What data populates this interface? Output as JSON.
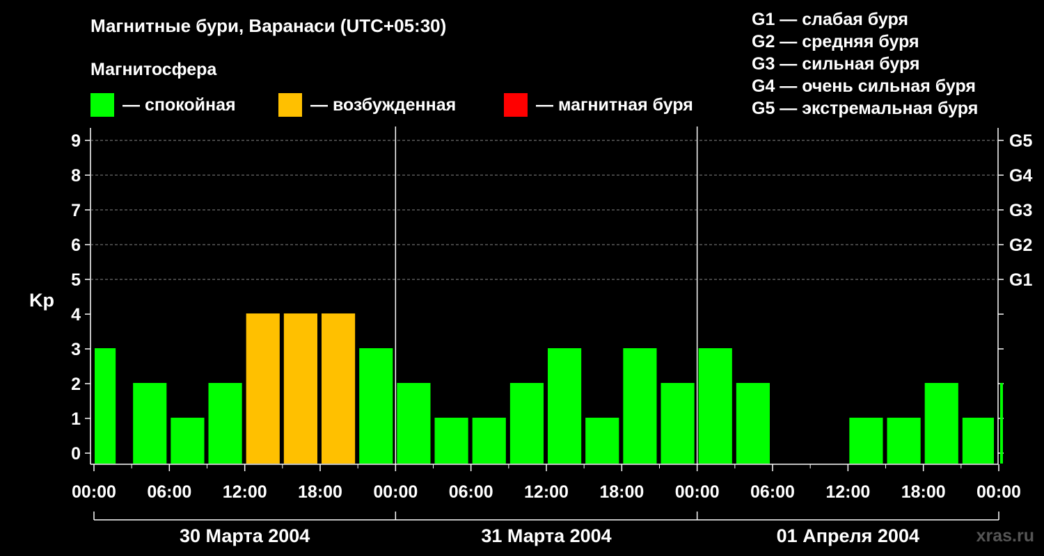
{
  "header": {
    "title": "Магнитные бури, Варанаси (UTC+05:30)",
    "subtitle": "Магнитосфера"
  },
  "legend": [
    {
      "label": "— спокойная",
      "color": "#00ff00"
    },
    {
      "label": "— возбужденная",
      "color": "#ffc000"
    },
    {
      "label": "— магнитная буря",
      "color": "#ff0000"
    }
  ],
  "storm_levels": [
    "G1 — слабая буря",
    "G2 — средняя буря",
    "G3 — сильная буря",
    "G4 — очень сильная буря",
    "G5 — экстремальная буря"
  ],
  "watermark": "xras.ru",
  "chart_data": {
    "type": "bar",
    "ylabel": "Kp",
    "ylim": [
      0,
      9
    ],
    "yticks": [
      "0",
      "1",
      "2",
      "3",
      "4",
      "5",
      "6",
      "7",
      "8",
      "9"
    ],
    "right_labels": [
      {
        "kp": 5,
        "label": "G1"
      },
      {
        "kp": 6,
        "label": "G2"
      },
      {
        "kp": 7,
        "label": "G3"
      },
      {
        "kp": 8,
        "label": "G4"
      },
      {
        "kp": 9,
        "label": "G5"
      }
    ],
    "xticks": [
      "00:00",
      "06:00",
      "12:00",
      "18:00",
      "00:00",
      "06:00",
      "12:00",
      "18:00",
      "00:00",
      "06:00",
      "12:00",
      "18:00",
      "00:00"
    ],
    "days": [
      "30 Марта 2004",
      "31 Марта 2004",
      "01 Апреля 2004"
    ],
    "grid": true,
    "colors": {
      "quiet": "#00ff00",
      "active": "#ffc000",
      "storm": "#ff0000"
    },
    "values": [
      3,
      2,
      1,
      2,
      4,
      4,
      4,
      3,
      2,
      1,
      1,
      2,
      3,
      1,
      3,
      2,
      3,
      2,
      0,
      0,
      1,
      1,
      2,
      1,
      2
    ]
  }
}
